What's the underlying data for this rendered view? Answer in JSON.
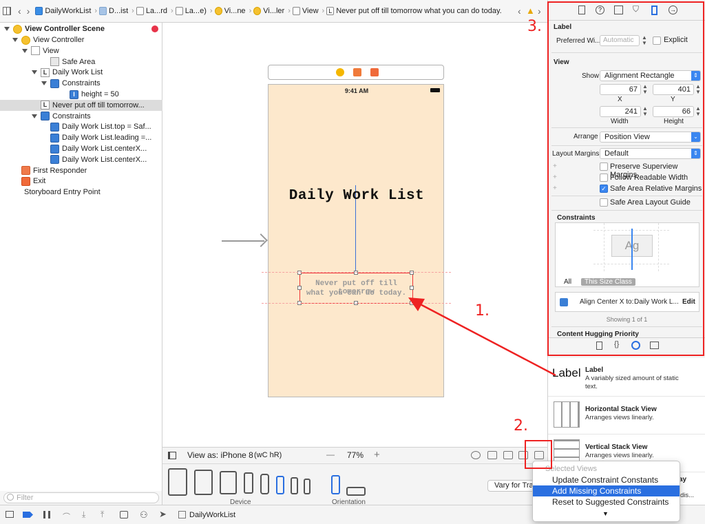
{
  "jumpbar": {
    "crumbs": [
      "DailyWorkList",
      "D...ist",
      "La...rd",
      "La...e)",
      "Vi...ne",
      "Vi...ler",
      "View",
      "Never put off till tomorrow what you can do today."
    ]
  },
  "outline": {
    "scene_title": "View Controller Scene",
    "rows": [
      {
        "label": "View Controller",
        "icon": "view-controller-icon",
        "glyph": ""
      },
      {
        "label": "View",
        "icon": "view-icon",
        "glyph": ""
      },
      {
        "label": "Safe Area",
        "icon": "safe-area-icon",
        "glyph": ""
      },
      {
        "label": "Daily Work List",
        "icon": "label-icon",
        "glyph": "L"
      },
      {
        "label": "Constraints",
        "icon": "constraints-icon",
        "glyph": ""
      },
      {
        "label": "height = 50",
        "icon": "constraint-icon",
        "glyph": "I"
      },
      {
        "label": "Never put off till tomorrow...",
        "icon": "label-icon",
        "glyph": "L"
      },
      {
        "label": "Constraints",
        "icon": "constraints-icon",
        "glyph": ""
      },
      {
        "label": "Daily Work List.top = Saf...",
        "icon": "constraint-icon",
        "glyph": ""
      },
      {
        "label": "Daily Work List.leading =...",
        "icon": "constraint-icon",
        "glyph": ""
      },
      {
        "label": "Daily Work List.centerX...",
        "icon": "constraint-icon",
        "glyph": ""
      },
      {
        "label": "Daily Work List.centerX...",
        "icon": "constraint-icon",
        "glyph": ""
      },
      {
        "label": "First Responder",
        "icon": "first-responder-icon",
        "glyph": ""
      },
      {
        "label": "Exit",
        "icon": "exit-icon",
        "glyph": ""
      },
      {
        "label": "Storyboard Entry Point",
        "icon": "entry-point-arrow-icon",
        "glyph": ""
      }
    ],
    "filter_placeholder": "Filter"
  },
  "canvas": {
    "status_time": "9:41 AM",
    "title_label": "Daily Work List",
    "quote_line1": "Never put off till tomorrow",
    "quote_line2": "what you can do today."
  },
  "bottombar": {
    "view_as": "View as: iPhone 8",
    "size_class": "(wC hR)",
    "zoom_minus": "—",
    "zoom": "77%",
    "zoom_plus": "+"
  },
  "devicebar": {
    "device_label": "Device",
    "orientation_label": "Orientation",
    "vary_button": "Vary for Trai"
  },
  "inspector": {
    "label_section": "Label",
    "preferred_width_label": "Preferred Wi...",
    "preferred_width_value": "Automatic",
    "explicit_label": "Explicit",
    "view_section": "View",
    "show_label": "Show",
    "show_value": "Alignment Rectangle",
    "x_value": "67",
    "y_value": "401",
    "x_label": "X",
    "y_label": "Y",
    "width_value": "241",
    "height_value": "66",
    "width_label": "Width",
    "height_label": "Height",
    "arrange_label": "Arrange",
    "arrange_value": "Position View",
    "layout_margins_label": "Layout Margins",
    "layout_margins_value": "Default",
    "preserve_label": "Preserve Superview Margins",
    "readable_label": "Follow Readable Width",
    "safe_relative_label": "Safe Area Relative Margins",
    "safe_guide_label": "Safe Area Layout Guide",
    "constraints_section": "Constraints",
    "ag_text": "Ag",
    "all_tab": "All",
    "size_class_tab": "This Size Class",
    "align_text": "Align Center X to:",
    "align_target": "Daily Work L...",
    "edit_label": "Edit",
    "showing_text": "Showing 1 of 1",
    "hugging_section": "Content Hugging Priority"
  },
  "library": {
    "items": [
      {
        "title": "Label",
        "desc": "A variably sized amount of static text.",
        "thumb": "Label"
      },
      {
        "title": "Horizontal Stack View",
        "desc": "Arranges views linearly.",
        "thumb": ""
      },
      {
        "title": "Vertical Stack View",
        "desc": "Arranges views linearly.",
        "thumb": ""
      }
    ],
    "partial_right_1": "ay",
    "partial_right_2": "dis..."
  },
  "menu": {
    "header": "Selected Views",
    "items": [
      "Update Constraint Constants",
      "Add Missing Constraints",
      "Reset to Suggested Constraints"
    ],
    "selected_index": 1
  },
  "statusbar": {
    "scheme": "DailyWorkList"
  },
  "annotations": {
    "one": "1.",
    "two": "2.",
    "three": "3."
  },
  "colors": {
    "accent": "#3a86f0",
    "annotation_red": "#ee2222",
    "canvas_bg": "#fde8cc"
  }
}
